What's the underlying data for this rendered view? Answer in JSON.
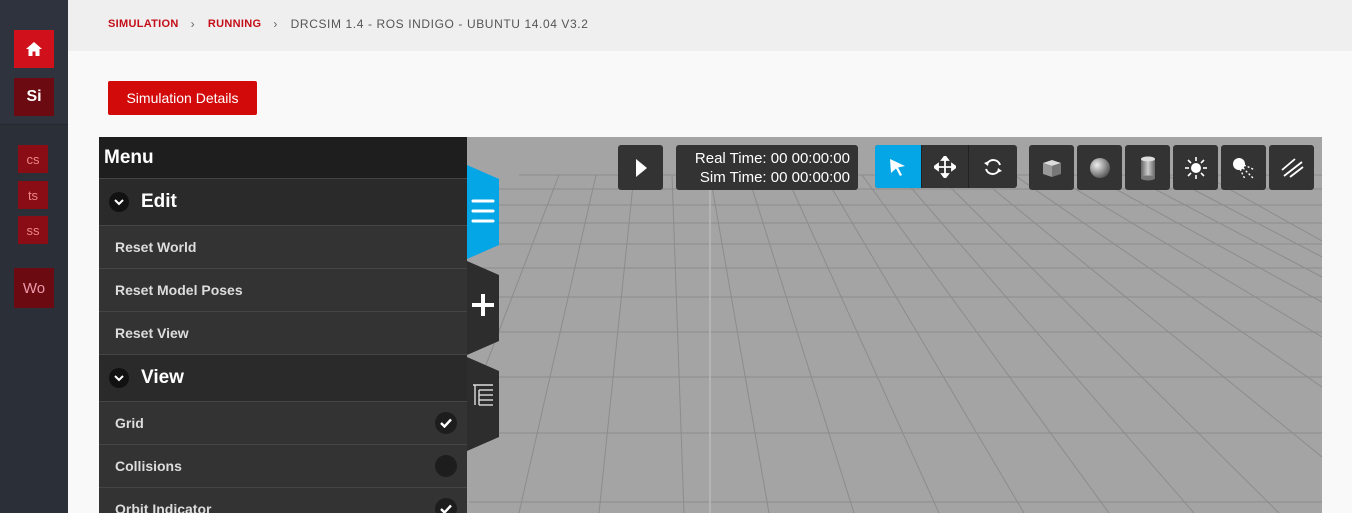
{
  "nav": {
    "home_icon": "home-icon",
    "si_label": "Si",
    "cs_label": "cs",
    "ts_label": "ts",
    "ss_label": "ss",
    "wo_label": "Wo"
  },
  "breadcrumb": {
    "items": [
      "SIMULATION",
      "RUNNING"
    ],
    "current": "DRCSIM 1.4 - ROS INDIGO - UBUNTU 14.04 V3.2"
  },
  "details_button": "Simulation Details",
  "menu": {
    "title": "Menu",
    "sections": [
      {
        "label": "Edit",
        "items": [
          "Reset World",
          "Reset Model Poses",
          "Reset View"
        ]
      },
      {
        "label": "View",
        "items": [
          {
            "label": "Grid",
            "checked": true
          },
          {
            "label": "Collisions",
            "checked": false
          },
          {
            "label": "Orbit Indicator",
            "checked": true
          }
        ]
      }
    ]
  },
  "time": {
    "real": "Real Time: 00 00:00:00",
    "sim": "Sim Time: 00 00:00:00"
  },
  "colors": {
    "accent": "#05a6e6",
    "brand_red": "#d30a0a",
    "crumb_red": "#c40d18"
  }
}
